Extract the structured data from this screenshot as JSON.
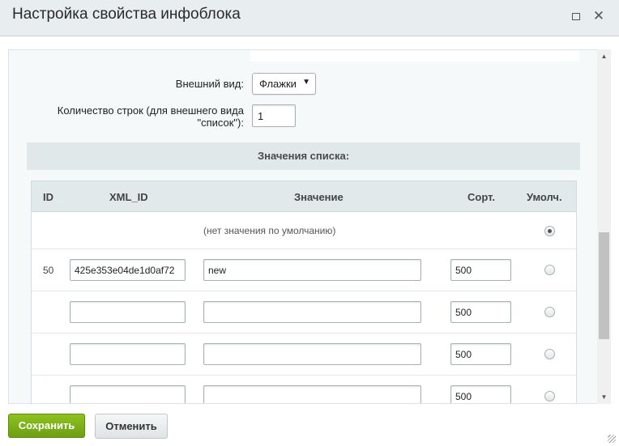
{
  "window": {
    "title": "Настройка свойства инфоблока"
  },
  "settings": {
    "view_label": "Внешний вид:",
    "view_value": "Флажки",
    "rows_label_line1": "Количество строк (для внешнего вида",
    "rows_label_line2": "\"список\"):",
    "rows_value": "1"
  },
  "list_values": {
    "section_title": "Значения списка:",
    "columns": {
      "id": "ID",
      "xml_id": "XML_ID",
      "value": "Значение",
      "sort": "Сорт.",
      "default": "Умолч."
    },
    "no_default_label": "(нет значения по умолчанию)",
    "rows": [
      {
        "id": "50",
        "xml_id": "425e353e04de1d0af72",
        "value": "new",
        "sort": "500",
        "is_default": false
      },
      {
        "id": "",
        "xml_id": "",
        "value": "",
        "sort": "500",
        "is_default": false
      },
      {
        "id": "",
        "xml_id": "",
        "value": "",
        "sort": "500",
        "is_default": false
      },
      {
        "id": "",
        "xml_id": "",
        "value": "",
        "sort": "500",
        "is_default": false
      }
    ]
  },
  "footer": {
    "save_label": "Сохранить",
    "cancel_label": "Отменить"
  },
  "icons": {
    "maximize": "maximize-icon",
    "close": "close-icon",
    "dropdown": "chevron-down-icon",
    "scroll_up": "arrow-up-icon",
    "scroll_down": "arrow-down-icon",
    "resize": "resize-grip-icon"
  },
  "colors": {
    "save_button": "#7cb518",
    "header_bg": "#e8eef0",
    "section_bg": "#e0e8ea"
  }
}
